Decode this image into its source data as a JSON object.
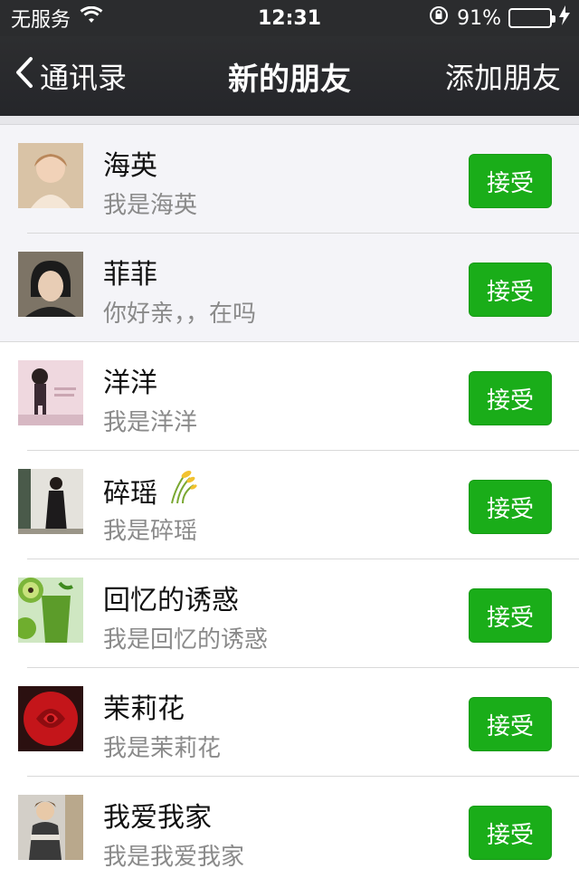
{
  "status_bar": {
    "carrier": "无服务",
    "time": "12:31",
    "battery_percent": "91%",
    "battery_level": 0.91,
    "icons": [
      "wifi-icon",
      "rotation-lock-icon",
      "battery-icon",
      "charging-icon"
    ]
  },
  "nav": {
    "back_label": "通讯录",
    "title": "新的朋友",
    "right_label": "添加朋友"
  },
  "friends": [
    {
      "name": "海英",
      "message": "我是海英",
      "action": "接受"
    },
    {
      "name": "菲菲",
      "message": "你好亲，，在吗",
      "action": "接受"
    },
    {
      "name": "洋洋",
      "message": "我是洋洋",
      "action": "接受"
    },
    {
      "name": "碎瑶",
      "message": "我是碎瑶",
      "action": "接受"
    },
    {
      "name": "回忆的诱惑",
      "message": "我是回忆的诱惑",
      "action": "接受"
    },
    {
      "name": "茉莉花",
      "message": "我是茉莉花",
      "action": "接受"
    },
    {
      "name": "我爱我家",
      "message": "我是我爱我家",
      "action": "接受"
    }
  ],
  "colors": {
    "accent": "#1aad19",
    "nav_bg": "#2b2c2e"
  }
}
